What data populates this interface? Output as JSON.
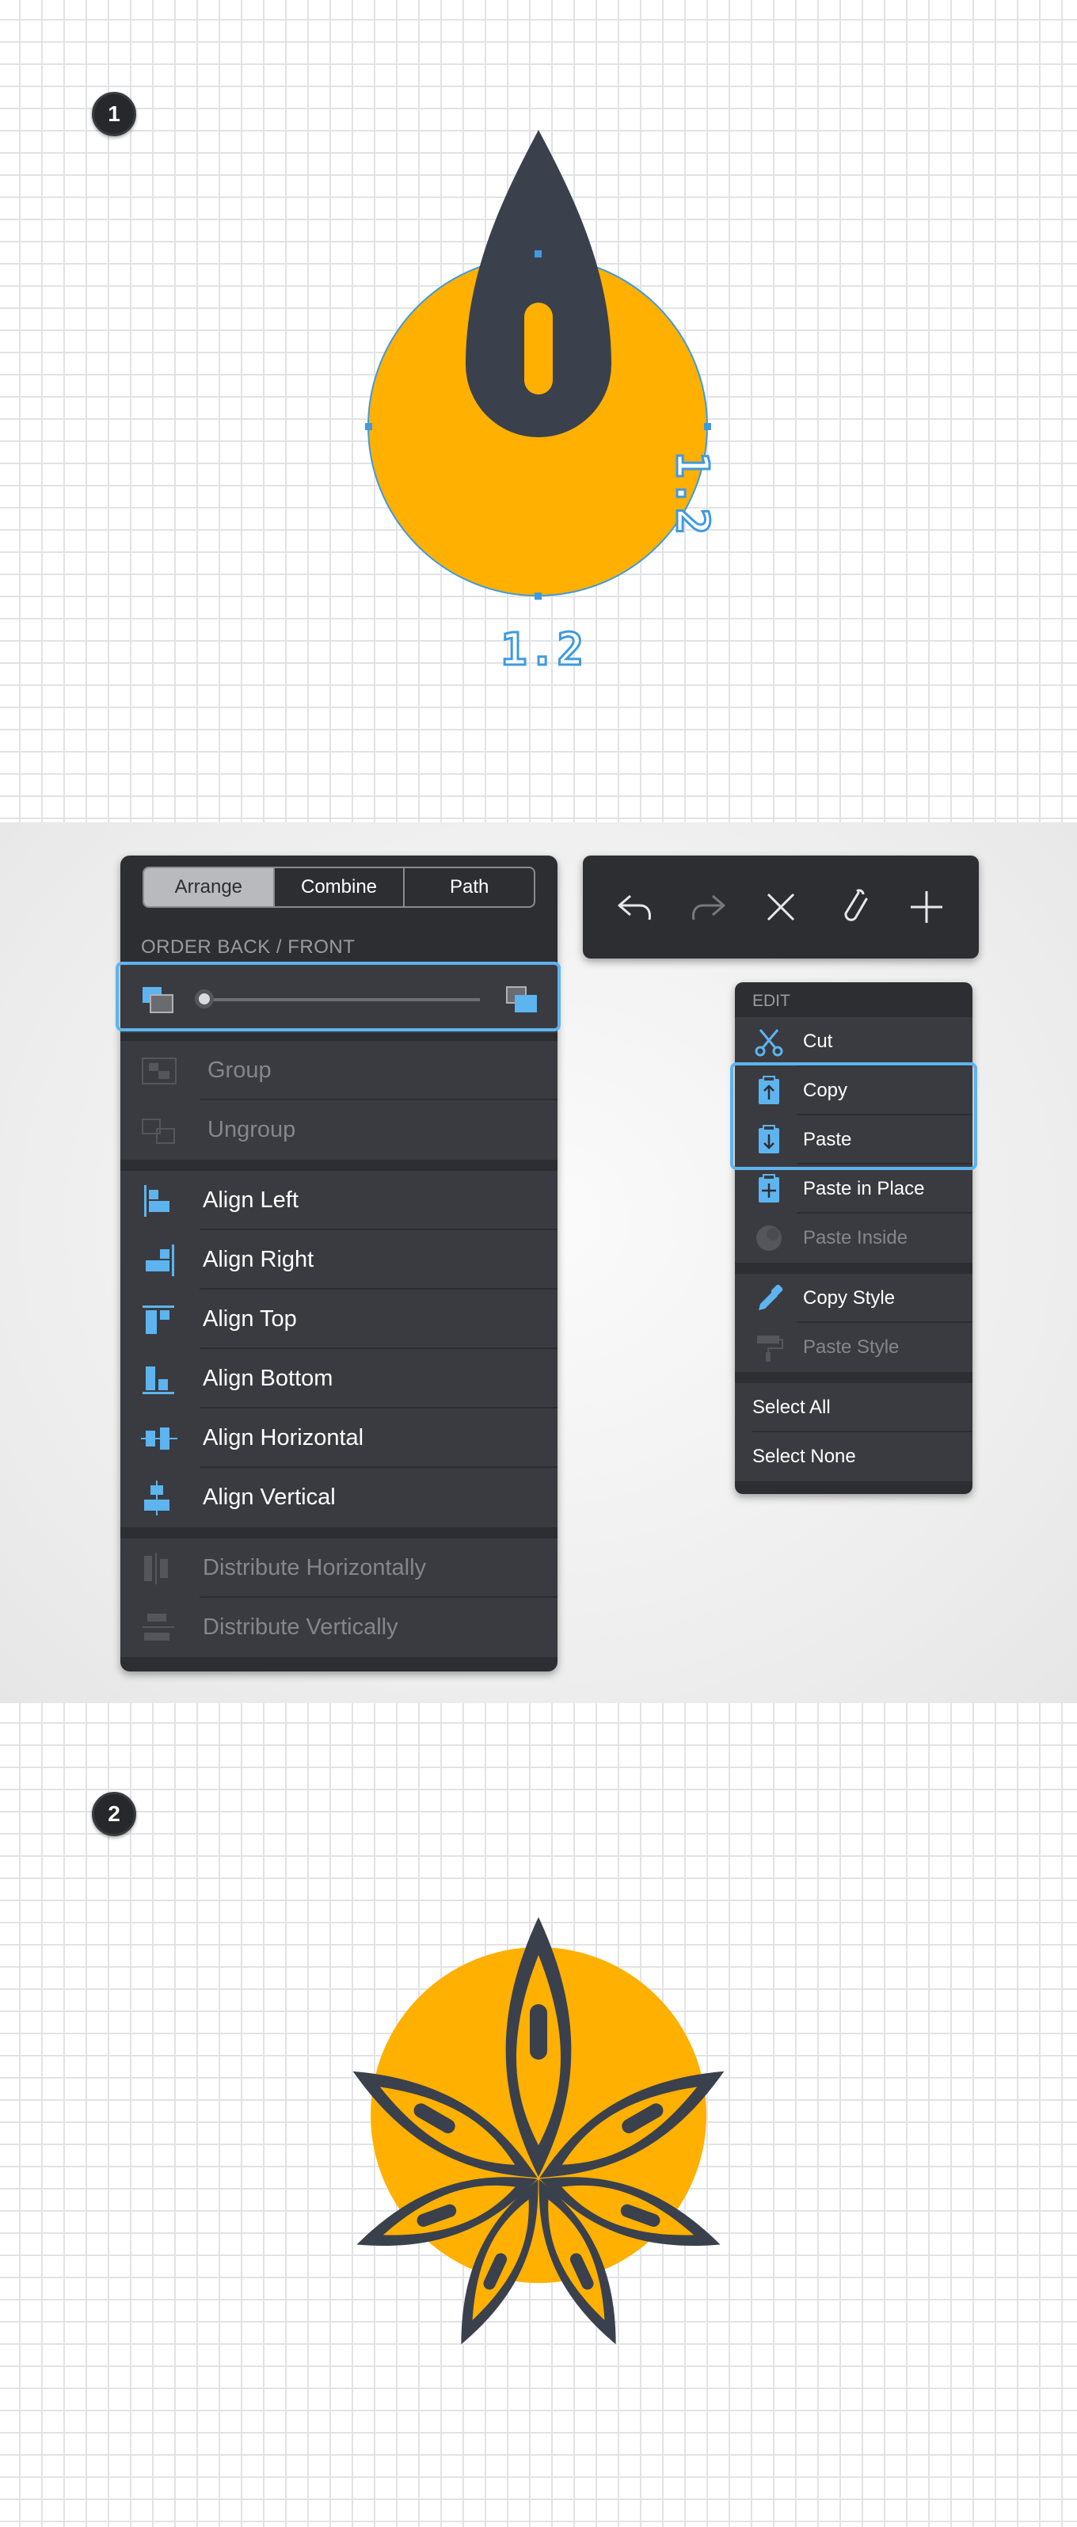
{
  "steps": {
    "step1": "1",
    "step2": "2"
  },
  "dimensions": {
    "width": "1.2",
    "height": "1.2"
  },
  "colors": {
    "accent_yellow": "#ffb000",
    "dark_shape": "#3a414d",
    "selection_blue": "#5db4ef",
    "panel_bg": "#2d2e32"
  },
  "arrange_panel": {
    "tabs": [
      {
        "label": "Arrange",
        "active": true
      },
      {
        "label": "Combine",
        "active": false
      },
      {
        "label": "Path",
        "active": false
      }
    ],
    "order_label": "ORDER BACK / FRONT",
    "order_icons": [
      "send-backward-icon",
      "bring-forward-icon"
    ],
    "items": [
      {
        "label": "Group",
        "icon": "group-icon",
        "enabled": false
      },
      {
        "label": "Ungroup",
        "icon": "ungroup-icon",
        "enabled": false
      },
      {
        "label": "Align Left",
        "icon": "align-left-icon",
        "enabled": true
      },
      {
        "label": "Align Right",
        "icon": "align-right-icon",
        "enabled": true
      },
      {
        "label": "Align Top",
        "icon": "align-top-icon",
        "enabled": true
      },
      {
        "label": "Align Bottom",
        "icon": "align-bottom-icon",
        "enabled": true
      },
      {
        "label": "Align Horizontal",
        "icon": "align-horizontal-icon",
        "enabled": true
      },
      {
        "label": "Align Vertical",
        "icon": "align-vertical-icon",
        "enabled": true
      },
      {
        "label": "Distribute Horizontally",
        "icon": "distribute-horizontally-icon",
        "enabled": false
      },
      {
        "label": "Distribute Vertically",
        "icon": "distribute-vertically-icon",
        "enabled": false
      }
    ]
  },
  "toolbar": {
    "tools": [
      "undo-icon",
      "redo-icon",
      "delete-icon",
      "clipboard-icon",
      "add-icon"
    ]
  },
  "edit_menu": {
    "title": "EDIT",
    "items": [
      {
        "label": "Cut",
        "icon": "scissors-icon",
        "enabled": true
      },
      {
        "label": "Copy",
        "icon": "copy-icon",
        "enabled": true
      },
      {
        "label": "Paste",
        "icon": "paste-icon",
        "enabled": true
      },
      {
        "label": "Paste in Place",
        "icon": "paste-in-place-icon",
        "enabled": true
      },
      {
        "label": "Paste Inside",
        "icon": "paste-inside-icon",
        "enabled": false
      },
      {
        "label": "Copy Style",
        "icon": "eyedropper-icon",
        "enabled": true
      },
      {
        "label": "Paste Style",
        "icon": "paint-roller-icon",
        "enabled": false
      },
      {
        "label": "Select All",
        "icon": "",
        "enabled": true
      },
      {
        "label": "Select None",
        "icon": "",
        "enabled": true
      }
    ]
  }
}
